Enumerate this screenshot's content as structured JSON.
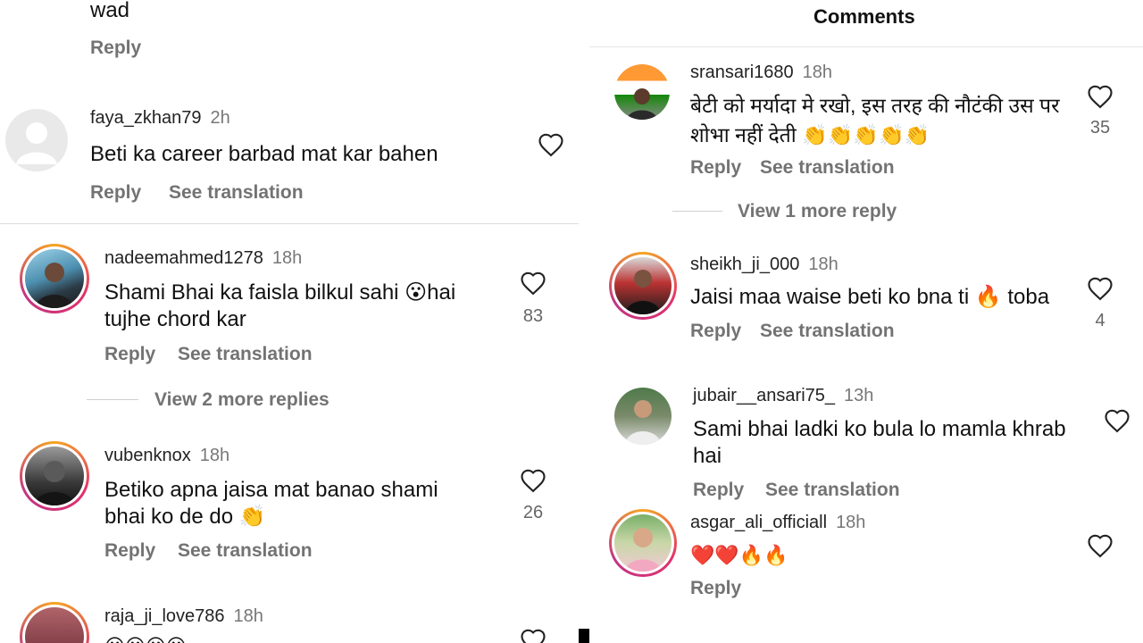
{
  "left": {
    "top_partial_text": "wad",
    "top_partial_reply": "Reply",
    "comments": [
      {
        "username": "faya_zkhan79",
        "time": "2h",
        "text": "Beti ka career barbad mat kar bahen",
        "reply": "Reply",
        "translate": "See translation",
        "likes": ""
      },
      {
        "username": "nadeemahmed1278",
        "time": "18h",
        "text": "Shami Bhai ka faisla bilkul sahi 😮hai tujhe chord kar",
        "reply": "Reply",
        "translate": "See translation",
        "likes": "83",
        "view_more": "View 2 more replies"
      },
      {
        "username": "vubenknox",
        "time": "18h",
        "text": "Betiko apna jaisa mat banao shami bhai ko de do 👏",
        "reply": "Reply",
        "translate": "See translation",
        "likes": "26"
      },
      {
        "username": "raja_ji_love786",
        "time": "18h",
        "text": "😀😀😀😀",
        "likes": ""
      }
    ]
  },
  "right": {
    "title": "Comments",
    "comments": [
      {
        "username": "sransari1680",
        "time": "18h",
        "text": "बेटी को मर्यादा मे रखो, इस तरह की नौटंकी उस पर शोभा नहीं देती 👏👏👏👏👏",
        "reply": "Reply",
        "translate": "See translation",
        "likes": "35",
        "view_more": "View 1 more reply"
      },
      {
        "username": "sheikh_ji_000",
        "time": "18h",
        "text": "Jaisi maa waise beti ko bna ti 🔥 toba",
        "reply": "Reply",
        "translate": "See translation",
        "likes": "4"
      },
      {
        "username": "jubair__ansari75_",
        "time": "13h",
        "text": "Sami bhai ladki ko bula lo mamla khrab hai",
        "reply": "Reply",
        "translate": "See translation",
        "likes": ""
      },
      {
        "username": "asgar_ali_officiall",
        "time": "18h",
        "text": "❤️❤️🔥🔥",
        "reply": "Reply",
        "likes": ""
      }
    ]
  },
  "icons": {
    "heart": "heart-icon",
    "default_avatar": "default-avatar-icon"
  },
  "colors": {
    "story_ring_start": "#f5a623",
    "story_ring_mid": "#e1306c",
    "muted_text": "#737373"
  }
}
